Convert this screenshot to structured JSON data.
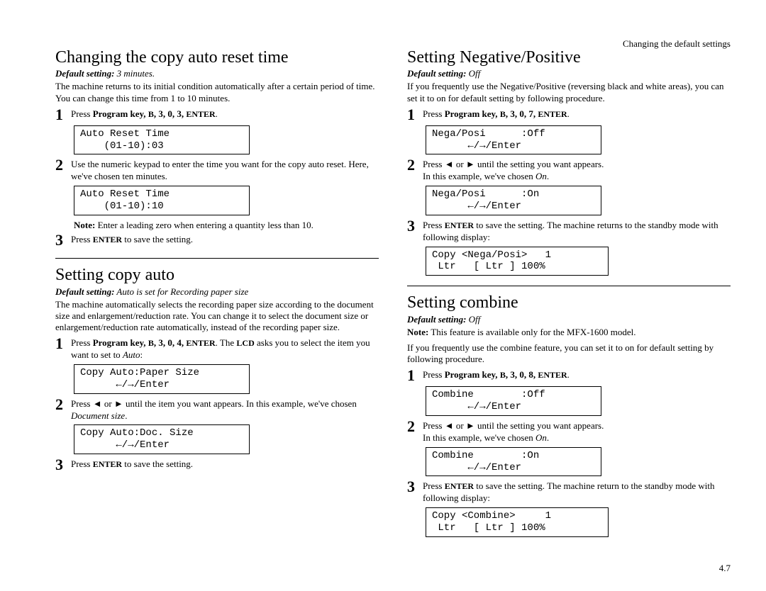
{
  "header": "Changing the default settings",
  "pagenum": "4.7",
  "left": {
    "s1": {
      "title": "Changing the copy auto reset time",
      "defaultLabel": "Default setting:",
      "defaultVal": " 3 minutes.",
      "intro": "The machine returns to its initial condition automatically after a certain period of time. You can change this time from 1 to 10 minutes.",
      "step1_a": "Press ",
      "step1_b": "Program key, ",
      "step1_c": "B",
      "step1_d": ", 3, 0, 3, ",
      "step1_e": "ENTER",
      "step1_f": ".",
      "lcd1": "Auto Reset Time\n    (01-10):03",
      "step2": "Use the numeric keypad to enter the time you want for the copy auto reset. Here, we've chosen ten minutes.",
      "lcd2": "Auto Reset Time\n    (01-10):10",
      "note": "Note:",
      "noteText": "  Enter a leading zero when entering a quantity less than 10.",
      "step3_a": "Press ",
      "step3_b": "ENTER",
      "step3_c": " to save the setting."
    },
    "s2": {
      "title": "Setting copy auto",
      "defaultLabel": "Default setting:",
      "defaultVal": " Auto is set for Recording paper size",
      "intro": "The machine automatically selects the recording paper size according to the document size and enlargement/reduction rate. You can change it to select the document size or enlargement/reduction rate automatically, instead of the recording paper size.",
      "step1_a": "Press ",
      "step1_b": "Program key, ",
      "step1_c": "B",
      "step1_d": ", 3, 0, 4, ",
      "step1_e": "ENTER",
      "step1_f": ". The ",
      "step1_g": "LCD",
      "step1_h": " asks you to select the item you want to set to ",
      "step1_i": "Auto",
      "step1_j": ":",
      "lcd1": "Copy Auto:Paper Size\n      ←/→/Enter",
      "step2_a": "Press ◄ or ► until the item you want appears. In this example, we've chosen ",
      "step2_b": "Document size",
      "step2_c": ".",
      "lcd2": "Copy Auto:Doc. Size\n      ←/→/Enter",
      "step3_a": "Press ",
      "step3_b": "ENTER",
      "step3_c": " to save the setting."
    }
  },
  "right": {
    "s1": {
      "title": "Setting Negative/Positive",
      "defaultLabel": "Default setting:",
      "defaultVal": " Off",
      "intro": "If you frequently use the Negative/Positive (reversing black and white areas), you can set it to on for default setting by following procedure.",
      "step1_a": "Press ",
      "step1_b": "Program key, ",
      "step1_c": "B",
      "step1_d": ", 3, 0, 7, ",
      "step1_e": "ENTER",
      "step1_f": ".",
      "lcd1": "Nega/Posi      :Off\n      ←/→/Enter",
      "step2_a": "Press ◄ or ► until the setting you want appears.",
      "step2_b": "In this example, we've chosen ",
      "step2_c": "On",
      "step2_d": ".",
      "lcd2": "Nega/Posi      :On\n      ←/→/Enter",
      "step3_a": "Press ",
      "step3_b": "ENTER",
      "step3_c": " to save the setting. The machine returns to the standby mode with following display:",
      "lcd3": "Copy <Nega/Posi>   1\n Ltr   [ Ltr ] 100%"
    },
    "s2": {
      "title": "Setting combine",
      "defaultLabel": "Default setting:",
      "defaultVal": " Off",
      "note": "Note:",
      "noteText": "  This feature is available only for the MFX-1600 model.",
      "intro": "If you frequently use the combine feature, you can set it to on for default setting by following procedure.",
      "step1_a": "Press ",
      "step1_b": "Program key, ",
      "step1_c": "B",
      "step1_d": ", 3, 0, 8, ",
      "step1_e": "ENTER",
      "step1_f": ".",
      "lcd1": "Combine        :Off\n      ←/→/Enter",
      "step2_a": "Press ◄ or ► until the setting you want appears.",
      "step2_b": "In this example, we've chosen ",
      "step2_c": "On",
      "step2_d": ".",
      "lcd2": "Combine        :On\n      ←/→/Enter",
      "step3_a": "Press ",
      "step3_b": "ENTER",
      "step3_c": " to save the setting. The machine return to the standby mode with following display:",
      "lcd3": "Copy <Combine>     1\n Ltr   [ Ltr ] 100%"
    }
  }
}
